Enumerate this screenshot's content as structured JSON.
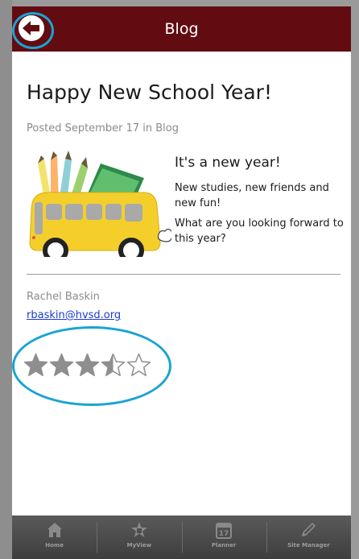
{
  "header": {
    "title": "Blog",
    "bar_color": "#620c12"
  },
  "post": {
    "title": "Happy New School Year!",
    "meta": "Posted September 17 in Blog",
    "headline": "It's a new year!",
    "paragraphs": [
      "New studies, new friends and new fun!",
      "What are you looking forward to this year?"
    ]
  },
  "author": {
    "name": "Rachel Baskin",
    "email": "rbaskin@hvsd.org"
  },
  "rating": {
    "value": 3.5,
    "max": 5
  },
  "tabs": [
    {
      "label": "Home",
      "icon": "home-icon"
    },
    {
      "label": "MyView",
      "icon": "star-icon"
    },
    {
      "label": "Planner",
      "icon": "calendar-icon"
    },
    {
      "label": "Site Manager",
      "icon": "pencil-icon"
    }
  ],
  "colors": {
    "highlight": "#1aa3d4",
    "link": "#1b3bd1",
    "star": "#8e8e8e"
  }
}
